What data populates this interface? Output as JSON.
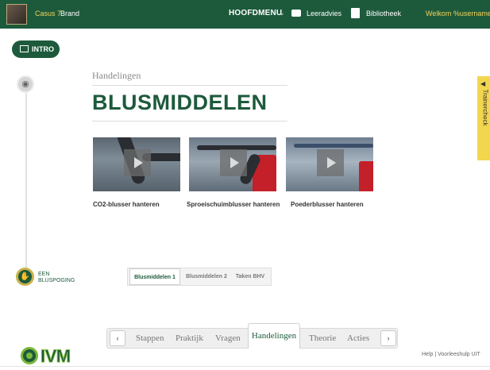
{
  "header": {
    "casus_label": "Casus 7",
    "casus_name": "Brand",
    "menu_label": "HOOFDMENU",
    "leeradvies_label": "Leeradvies",
    "bibliotheek_label": "Bibliotheek",
    "welcome_text": "Welkom %username%"
  },
  "intro": {
    "label": "INTRO"
  },
  "timeline": {
    "step_label_line1": "EEN",
    "step_label_line2": "BLUSPOGING"
  },
  "content": {
    "breadcrumb": "Handelingen",
    "title": "BLUSMIDDELEN",
    "videos": [
      {
        "caption": "CO2-blusser hanteren"
      },
      {
        "caption": "Sproeischuimblusser hanteren"
      },
      {
        "caption": "Poederblusser hanteren"
      }
    ]
  },
  "subtabs": [
    {
      "label": "Blusmiddelen 1",
      "active": true
    },
    {
      "label": "Blusmiddelen 2",
      "active": false
    },
    {
      "label": "Taken BHV",
      "active": false
    }
  ],
  "side_tab": {
    "label": "Trainercheck"
  },
  "bottom_nav": {
    "prev": "‹",
    "next": "›",
    "items": [
      "Stappen",
      "Praktijk",
      "Vragen",
      "Handelingen",
      "Theorie",
      "Acties"
    ],
    "active": "Handelingen"
  },
  "logo": {
    "text": "IVM"
  },
  "footer": {
    "help_text": "Help | Voorleeshulp UIT"
  },
  "colors": {
    "brand_green": "#1d5a3c",
    "accent_yellow": "#f3d35a",
    "trainer_tab": "#f2d64e"
  },
  "icons": {
    "intro": "play-screen-icon",
    "eye": "eye-icon",
    "step": "hand-icon",
    "leeradvies": "chat-icon",
    "bibliotheek": "book-icon"
  }
}
